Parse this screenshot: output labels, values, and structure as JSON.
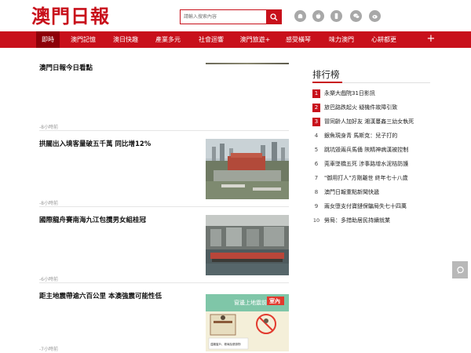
{
  "header": {
    "logo": "澳門日報",
    "search_placeholder": "請輸入搜索內容",
    "social_icons": [
      "android-icon",
      "apple-icon",
      "mobile-icon",
      "wechat-icon",
      "weibo-icon"
    ]
  },
  "nav": {
    "items": [
      "即時",
      "澳門記憶",
      "澳日快趣",
      "產業多元",
      "社會迴響",
      "澳門旅遊+",
      "感受橫琴",
      "味力澳門",
      "心耕都更"
    ],
    "plus": "+"
  },
  "articles": [
    {
      "title": "澳門日報今日看點",
      "time": "-8小時前"
    },
    {
      "title": "拱關出入境客量破五千萬 同比增12%",
      "time": "-8小時前"
    },
    {
      "title": "國際龍舟賽南海九江包攬男女組桂冠",
      "time": "-6小時前"
    },
    {
      "title": "距主地震帶逾六百公里 本澳強震可能性低",
      "time": "-7小時前"
    }
  ],
  "poster": {
    "header": "窗邊上地震前",
    "badge": "室內",
    "caption": "遠離窗戶、玻璃及懸掛物"
  },
  "ranking": {
    "title": "排行榜",
    "items": [
      {
        "num": "1",
        "text": "永樂大戲院31日影訊"
      },
      {
        "num": "2",
        "text": "旅巴路跌起火 疑機件故障引致"
      },
      {
        "num": "3",
        "text": "冒同齡人加好友 湘漢蔓姦三幼女執死"
      },
      {
        "num": "4",
        "text": "銀魚現身青 馬斯克：兒子打的"
      },
      {
        "num": "5",
        "text": "跳坑毀兩兵馬俑 陝精神病漢被控制"
      },
      {
        "num": "6",
        "text": "莞車墜橋五死 涉事路增水泥桔防護"
      },
      {
        "num": "7",
        "text": "\"御用打人\"方剛離世 終年七十八歲"
      },
      {
        "num": "8",
        "text": "澳門日報重點新聞快遞"
      },
      {
        "num": "9",
        "text": "兩女墮支付寶鏈保騙局失七十四萬"
      },
      {
        "num": "10",
        "text": "勞局：多措助居民持續就業"
      }
    ]
  },
  "colors": {
    "brand": "#c8101b",
    "nav_active": "#8e0008"
  }
}
